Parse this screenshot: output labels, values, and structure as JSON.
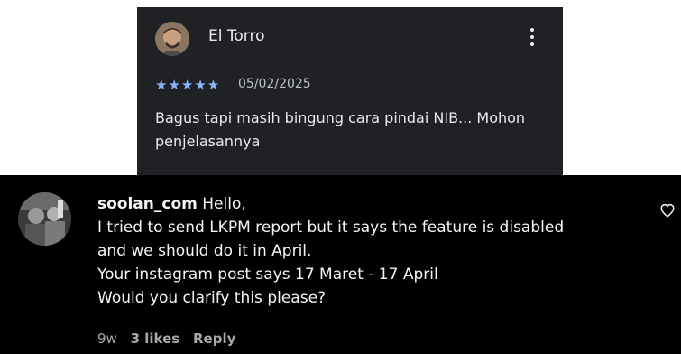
{
  "review": {
    "author": "El Torro",
    "rating_stars": "★★★★★",
    "rating": 5,
    "date": "05/02/2025",
    "text": "Bagus tapi masih bingung cara pindai NIB... Mohon penjelasannya",
    "star_color": "#8ab4f8",
    "background": "#202124"
  },
  "comment": {
    "username": "soolan_com",
    "lines": [
      "Hello,",
      "I tried to send LKPM report but it says the feature is disabled",
      "and we should do it in April.",
      "Your instagram post says 17 Maret - 17 April",
      "Would you clarify this please?"
    ],
    "age": "9w",
    "likes": "3 likes",
    "reply": "Reply",
    "like_icon": "heart-outline-icon",
    "background": "#000000"
  }
}
